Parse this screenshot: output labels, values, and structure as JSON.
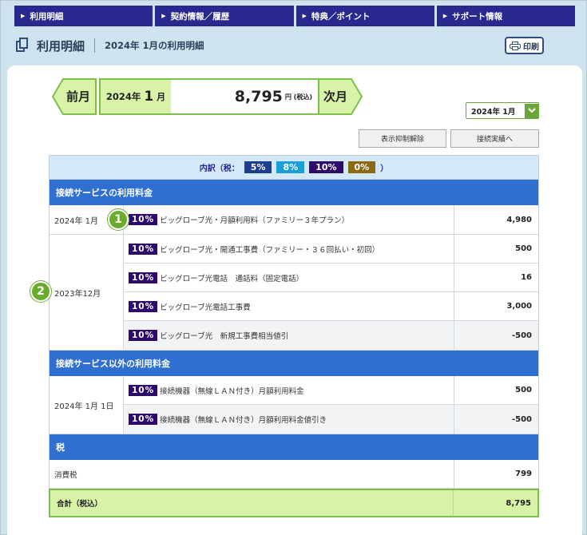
{
  "nav": [
    {
      "label": "利用明細"
    },
    {
      "label": "契約情報／履歴"
    },
    {
      "label": "特典／ポイント"
    },
    {
      "label": "サポート情報"
    }
  ],
  "header": {
    "title": "利用明細",
    "subtitle": "2024年 1月の利用明細",
    "print_label": "印刷"
  },
  "month_nav": {
    "prev_label": "前月",
    "next_label": "次月",
    "year_label": "2024年",
    "month_number": "1",
    "month_unit": "月",
    "total_amount": "8,795",
    "total_unit": "円 (税込)"
  },
  "month_select": {
    "value": "2024年 1月"
  },
  "buttons": {
    "suppress_label": "表示抑制解除",
    "history_label": "接続実績へ"
  },
  "breakdown": {
    "prefix": "内訳（税：",
    "suffix": "）",
    "rates": [
      {
        "label": "5%",
        "color": "#1f3d8f"
      },
      {
        "label": "8%",
        "color": "#1b9fd6"
      },
      {
        "label": "10%",
        "color": "#2e0a6a"
      },
      {
        "label": "0%",
        "color": "#8a6a12"
      }
    ]
  },
  "section1": {
    "title": "接続サービスの利用料金",
    "groups": [
      {
        "date": "2024年 1月",
        "items": [
          {
            "badge": "10%",
            "desc": "ビッグローブ光・月額利用料（ファミリー３年プラン）",
            "value": "4,980"
          }
        ]
      },
      {
        "date": "2023年12月",
        "items": [
          {
            "badge": "10%",
            "desc": "ビッグローブ光・開通工事費（ファミリー・３６回払い・初回）",
            "value": "500"
          },
          {
            "badge": "10%",
            "desc": "ビッグローブ光電話　通話料（固定電話）",
            "value": "16"
          },
          {
            "badge": "10%",
            "desc": "ビッグローブ光電話工事費",
            "value": "3,000"
          },
          {
            "badge": "10%",
            "desc": "ビッグローブ光　新規工事費相当値引",
            "value": "-500"
          }
        ]
      }
    ]
  },
  "section2": {
    "title": "接続サービス以外の利用料金",
    "groups": [
      {
        "date": "2024年 1月 1日",
        "items": [
          {
            "badge": "10%",
            "desc": "接続機器（無線ＬＡＮ付き）月額利用料金",
            "value": "500"
          },
          {
            "badge": "10%",
            "desc": "接続機器（無線ＬＡＮ付き）月額利用料金値引き",
            "value": "-500"
          }
        ]
      }
    ]
  },
  "section3": {
    "title": "税",
    "tax_label": "消費税",
    "tax_value": "799"
  },
  "total": {
    "label": "合計（税込）",
    "value": "8,795"
  },
  "markers": {
    "m1": "1",
    "m2": "2"
  }
}
